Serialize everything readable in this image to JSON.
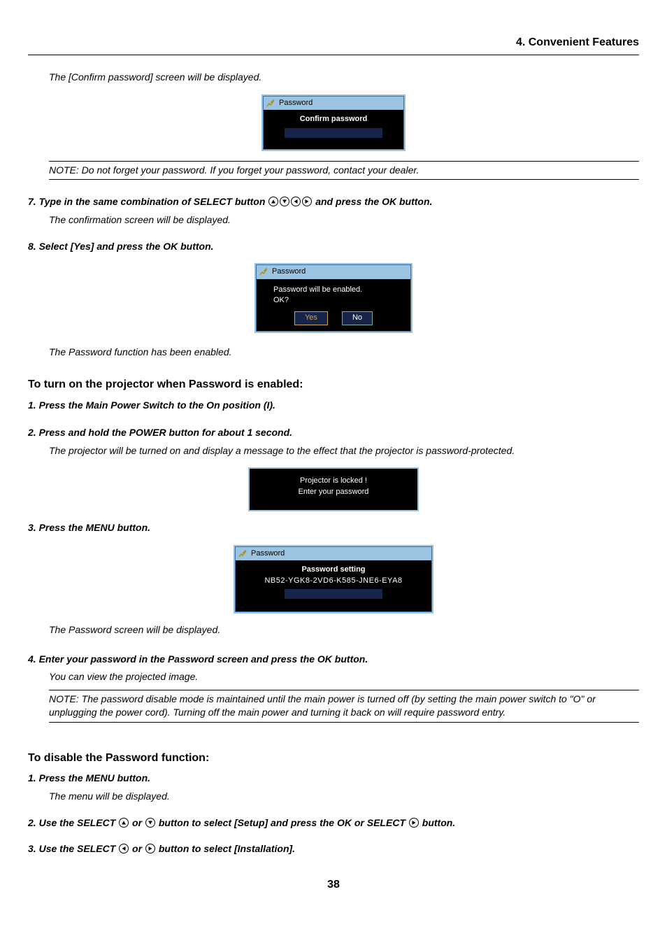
{
  "chapter": "4. Convenient Features",
  "intro_line": "The [Confirm password] screen will be displayed.",
  "dlg1": {
    "title": "Password",
    "body": "Confirm password"
  },
  "note1": "NOTE: Do not forget your password. If you forget your password, contact your dealer.",
  "step7": {
    "num": "7.",
    "lead": "Type in the same combination of SELECT button",
    "tail": " and press the OK button.",
    "sub": "The confirmation screen will be displayed."
  },
  "step8": {
    "num": "8.",
    "text": "Select [Yes] and press the OK button."
  },
  "dlg2": {
    "title": "Password",
    "line1": "Password will be enabled.",
    "line2": "OK?",
    "yes": "Yes",
    "no": "No"
  },
  "after_dlg2": "The Password function has been enabled.",
  "secA_title": "To turn on the projector when Password is enabled:",
  "secA_s1": {
    "num": "1.",
    "text": "Press the Main Power Switch to the On position (I)."
  },
  "secA_s2": {
    "num": "2.",
    "text": "Press and hold the POWER  button for about 1 second.",
    "sub": "The projector will be turned on and display a message to the effect that the projector is password-protected."
  },
  "locked": {
    "line1": "Projector is locked !",
    "line2": "Enter your password"
  },
  "secA_s3": {
    "num": "3.",
    "text": "Press the MENU button."
  },
  "dlg3": {
    "title": "Password",
    "line1": "Password setting",
    "code": "NB52-YGK8-2VD6-K585-JNE6-EYA8"
  },
  "after_dlg3": "The Password screen will be displayed.",
  "secA_s4": {
    "num": "4.",
    "text": "Enter your password in the Password screen and press the OK button.",
    "sub": "You can view the projected image."
  },
  "note2": "NOTE: The password disable mode is maintained until the main power is turned off (by setting the main power switch to \"O\" or unplugging the power cord). Turning off the main power and turning it back on will require password entry.",
  "secB_title": "To disable the Password function:",
  "secB_s1": {
    "num": "1.",
    "text": "Press the MENU button.",
    "sub": "The menu will be displayed."
  },
  "secB_s2": {
    "num": "2.",
    "lead": "Use the SELECT ",
    "mid": " or ",
    "mid2": " button to select [Setup] and press the OK or SELECT ",
    "tail": " button."
  },
  "secB_s3": {
    "num": "3.",
    "lead": "Use the SELECT ",
    "mid": " or ",
    "tail": " button to select [Installation]."
  },
  "page": "38"
}
